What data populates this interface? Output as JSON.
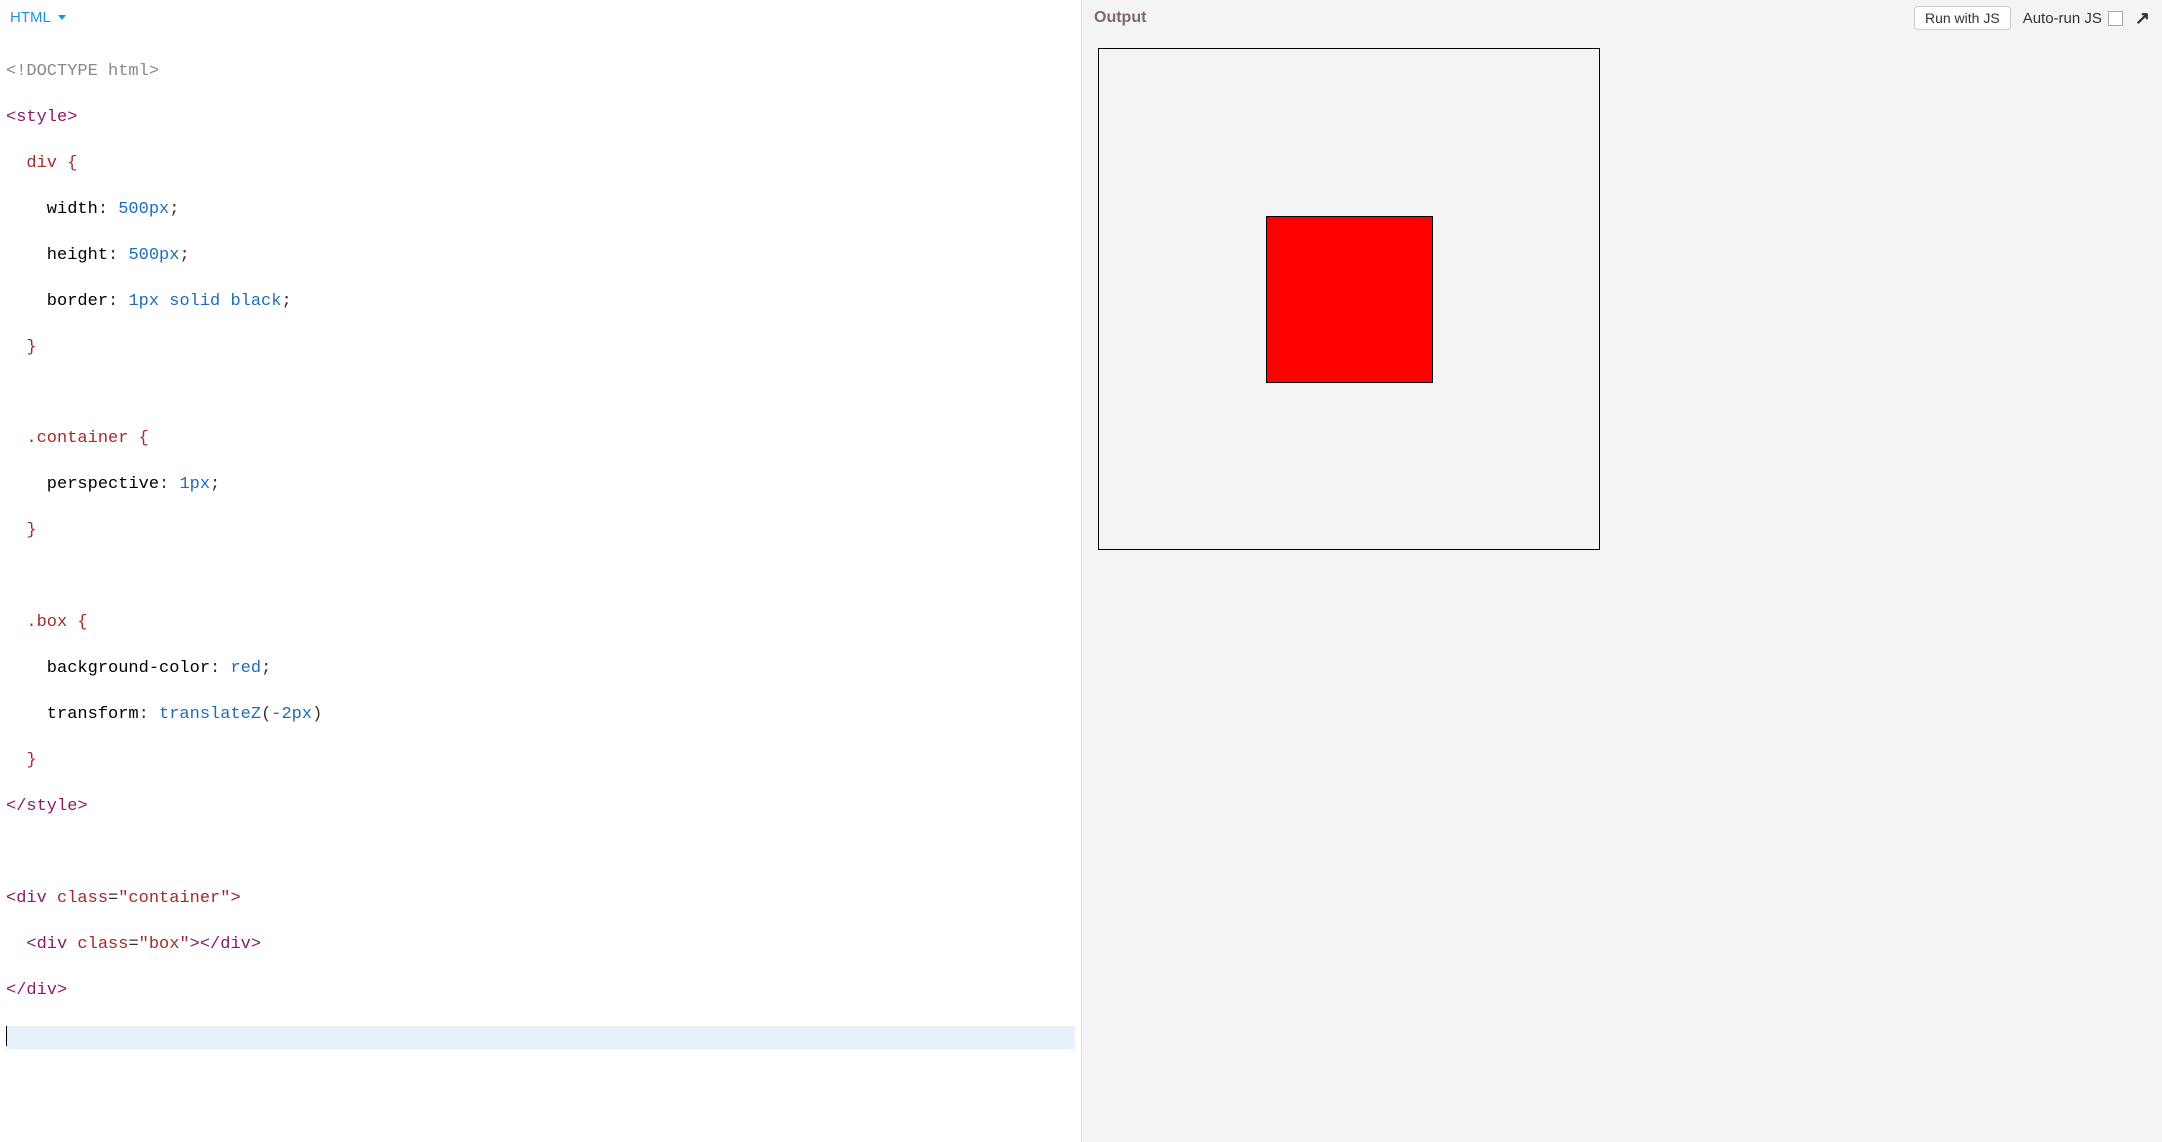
{
  "header": {
    "language_label": "HTML",
    "output_label": "Output",
    "run_button_label": "Run with JS",
    "autorun_label": "Auto-run JS"
  },
  "code": {
    "lines": {
      "l1_doctype": "<!DOCTYPE html>",
      "l2_open_style": "<style>",
      "l3_sel_div": "  div {",
      "l4_width_prop": "    width",
      "l4_width_colon": ": ",
      "l4_width_val": "500px",
      "l4_width_semi": ";",
      "l5_height_prop": "    height",
      "l5_height_colon": ": ",
      "l5_height_val": "500px",
      "l5_height_semi": ";",
      "l6_border_prop": "    border",
      "l6_border_colon": ": ",
      "l6_border_val": "1px solid black",
      "l6_border_semi": ";",
      "l7_close": "  }",
      "l8_blank": "",
      "l9_sel_container": "  .container {",
      "l10_persp_prop": "    perspective",
      "l10_persp_colon": ": ",
      "l10_persp_val": "1px",
      "l10_persp_semi": ";",
      "l11_close": "  }",
      "l12_blank": "",
      "l13_sel_box": "  .box {",
      "l14_bg_prop": "    background-color",
      "l14_bg_colon": ": ",
      "l14_bg_val": "red",
      "l14_bg_semi": ";",
      "l15_tf_prop": "    transform",
      "l15_tf_colon": ": ",
      "l15_tf_func": "translateZ",
      "l15_tf_open": "(",
      "l15_tf_val": "-2px",
      "l15_tf_close": ")",
      "l16_close": "  }",
      "l17_close_style": "</style>",
      "l18_blank": "",
      "l19_div_open": "<div",
      "l19_sp": " ",
      "l19_attr": "class",
      "l19_eq": "=",
      "l19_val": "\"container\"",
      "l19_gt": ">",
      "l20_indent": "  ",
      "l20_div_open": "<div",
      "l20_sp": " ",
      "l20_attr": "class",
      "l20_eq": "=",
      "l20_val": "\"box\"",
      "l20_gt": ">",
      "l20_close": "</div>",
      "l21_close": "</div>"
    }
  },
  "preview": {
    "box_color": "red"
  }
}
